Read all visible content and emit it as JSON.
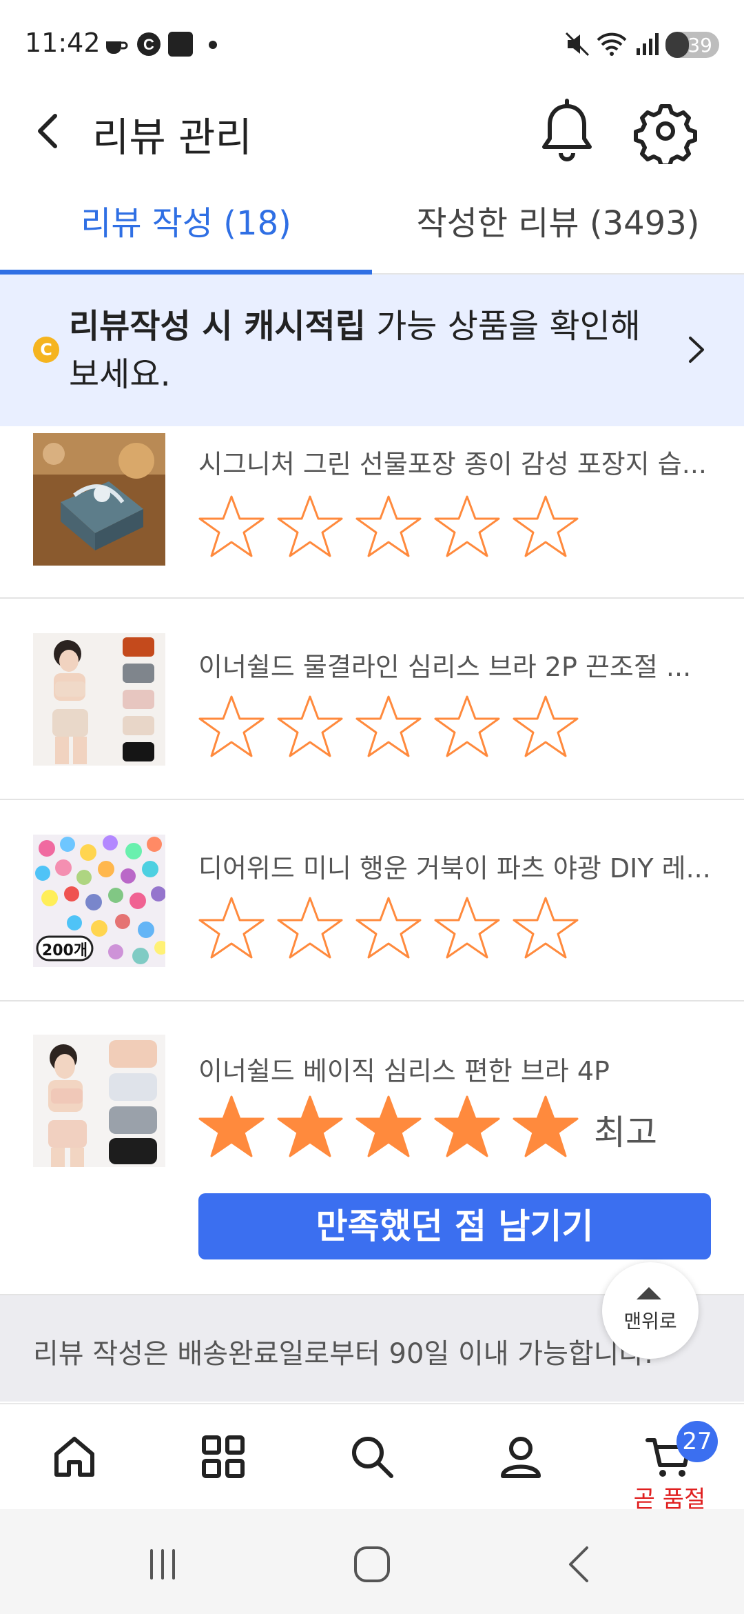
{
  "status_bar": {
    "time": "11:42",
    "battery": "39"
  },
  "header": {
    "title": "리뷰 관리"
  },
  "tabs": [
    {
      "label": "리뷰 작성 (18)",
      "active": true
    },
    {
      "label": "작성한 리뷰 (3493)",
      "active": false
    }
  ],
  "banner": {
    "coin": "C",
    "bold": "리뷰작성 시 캐시적립",
    "rest": " 가능 상품을 확인해보세요."
  },
  "items": [
    {
      "title": "시그니처 그린 선물포장 종이 감성 포장지 습...",
      "rating": 0
    },
    {
      "title": "이너쉴드 물결라인 심리스 브라 2P 끈조절 ...",
      "rating": 0
    },
    {
      "title": "디어위드 미니 행운 거북이 파츠 야광 DIY 레...",
      "rating": 0,
      "thumb_badge": "200개"
    },
    {
      "title": "이너쉴드 베이직 심리스 편한 브라 4P",
      "rating": 5,
      "rating_label": "최고",
      "button": "만족했던 점 남기기"
    }
  ],
  "footer_note": "리뷰 작성은 배송완료일로부터 90일 이내 가능합니다.",
  "top_button": "맨위로",
  "bottom_nav": {
    "cart_badge": "27",
    "cart_label": "곧 품절"
  },
  "colors": {
    "accent": "#2f6fe4",
    "button": "#3b6ff0",
    "star": "#ff8a3d",
    "banner_bg": "#e9efff"
  }
}
